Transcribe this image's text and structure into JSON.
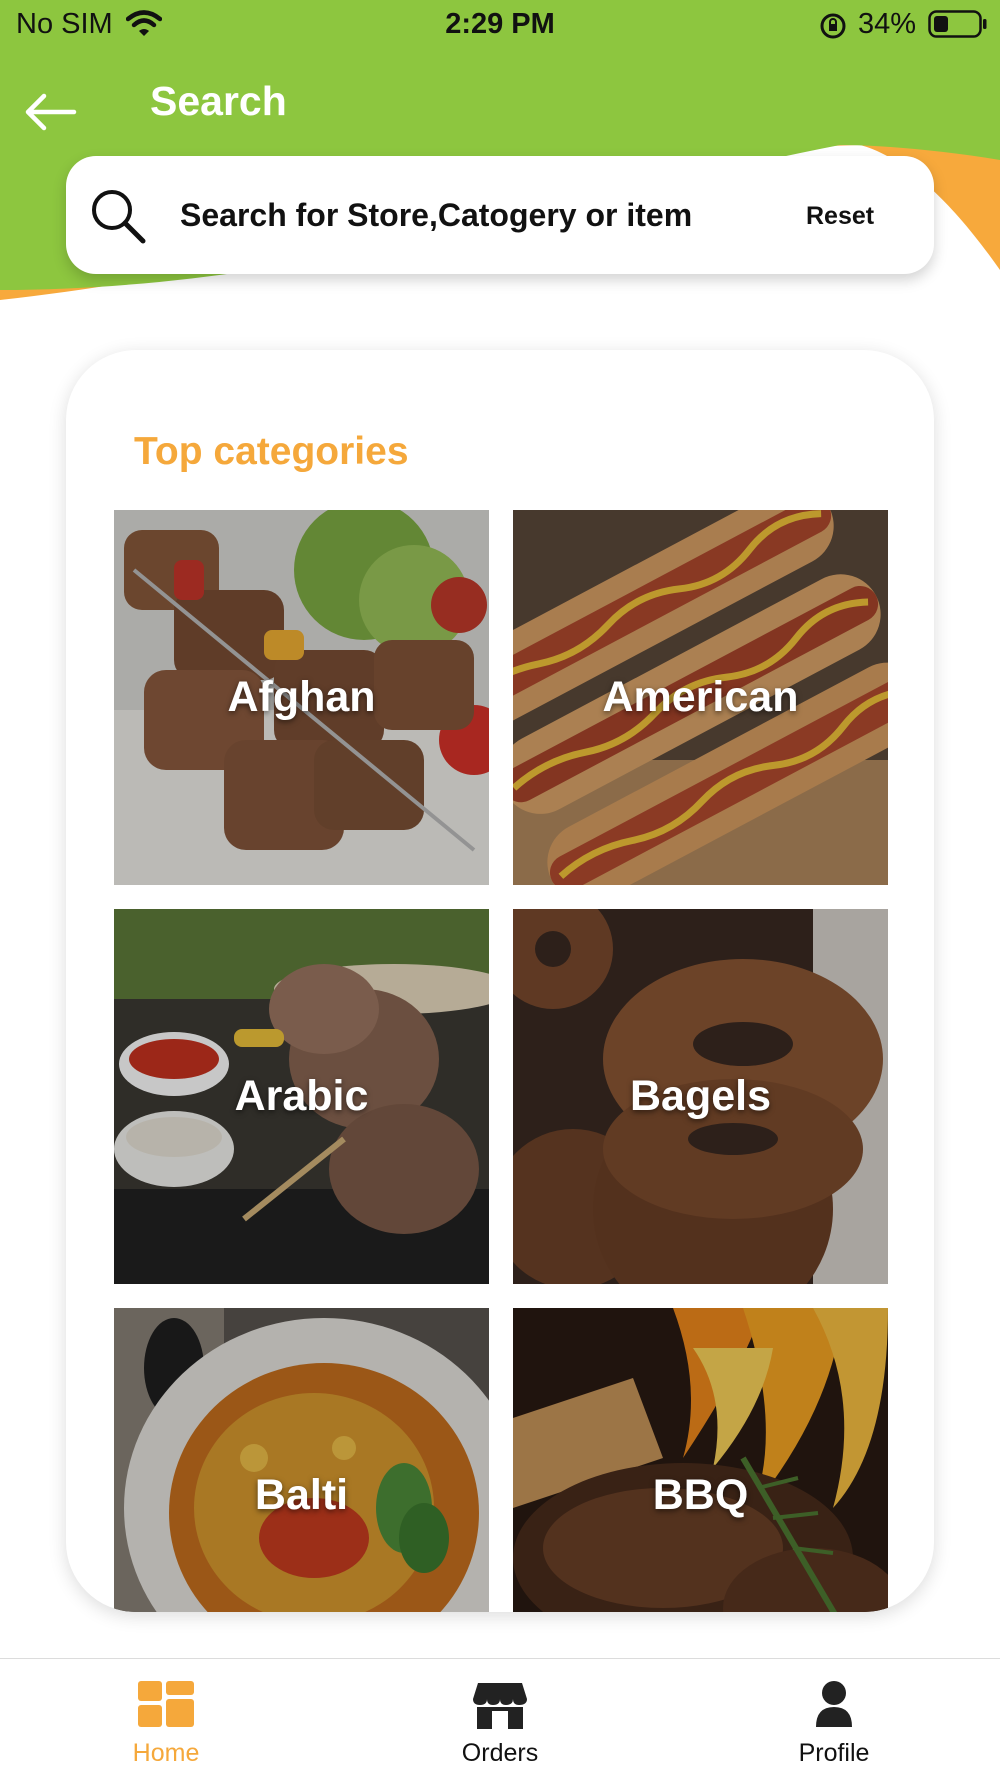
{
  "colors": {
    "header_green": "#8dc63f",
    "accent_orange": "#f5a83b",
    "background": "#ffffff"
  },
  "status_bar": {
    "carrier": "No SIM",
    "time": "2:29 PM",
    "battery": "34%"
  },
  "header": {
    "title": "Search",
    "back_icon": "arrow-left-icon"
  },
  "search": {
    "placeholder": "Search for Store,Catogery or item",
    "value": "",
    "reset_label": "Reset"
  },
  "categories": {
    "title": "Top categories",
    "items": [
      {
        "label": "Afghan"
      },
      {
        "label": "American"
      },
      {
        "label": "Arabic"
      },
      {
        "label": "Bagels"
      },
      {
        "label": "Balti"
      },
      {
        "label": "BBQ"
      }
    ]
  },
  "nav": {
    "items": [
      {
        "label": "Home",
        "icon": "dashboard-icon",
        "active": true
      },
      {
        "label": "Orders",
        "icon": "store-icon",
        "active": false
      },
      {
        "label": "Profile",
        "icon": "person-icon",
        "active": false
      }
    ]
  }
}
